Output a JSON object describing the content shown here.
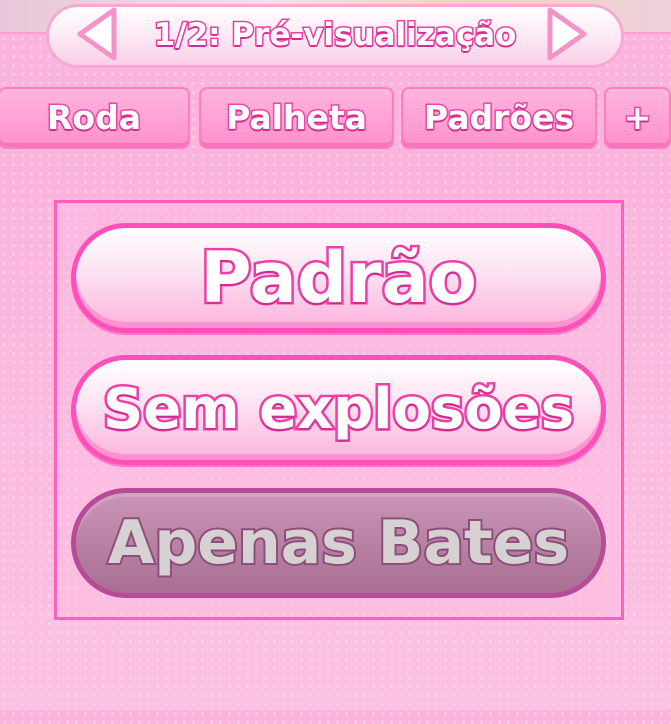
{
  "header": {
    "title": "1/2: Pré-visualização",
    "prev_icon": "triangle-left-icon",
    "next_icon": "triangle-right-icon"
  },
  "tabs": [
    {
      "label": "Roda"
    },
    {
      "label": "Palheta"
    },
    {
      "label": "Padrões"
    },
    {
      "label": "+"
    }
  ],
  "options": [
    {
      "label": "Padrão",
      "state": "enabled"
    },
    {
      "label": "Sem explosões",
      "state": "enabled"
    },
    {
      "label": "Apenas Bates",
      "state": "disabled"
    }
  ],
  "colors": {
    "accent": "#ff4fb8",
    "panel": "#fbb4dc",
    "disabled": "#a86f93"
  }
}
